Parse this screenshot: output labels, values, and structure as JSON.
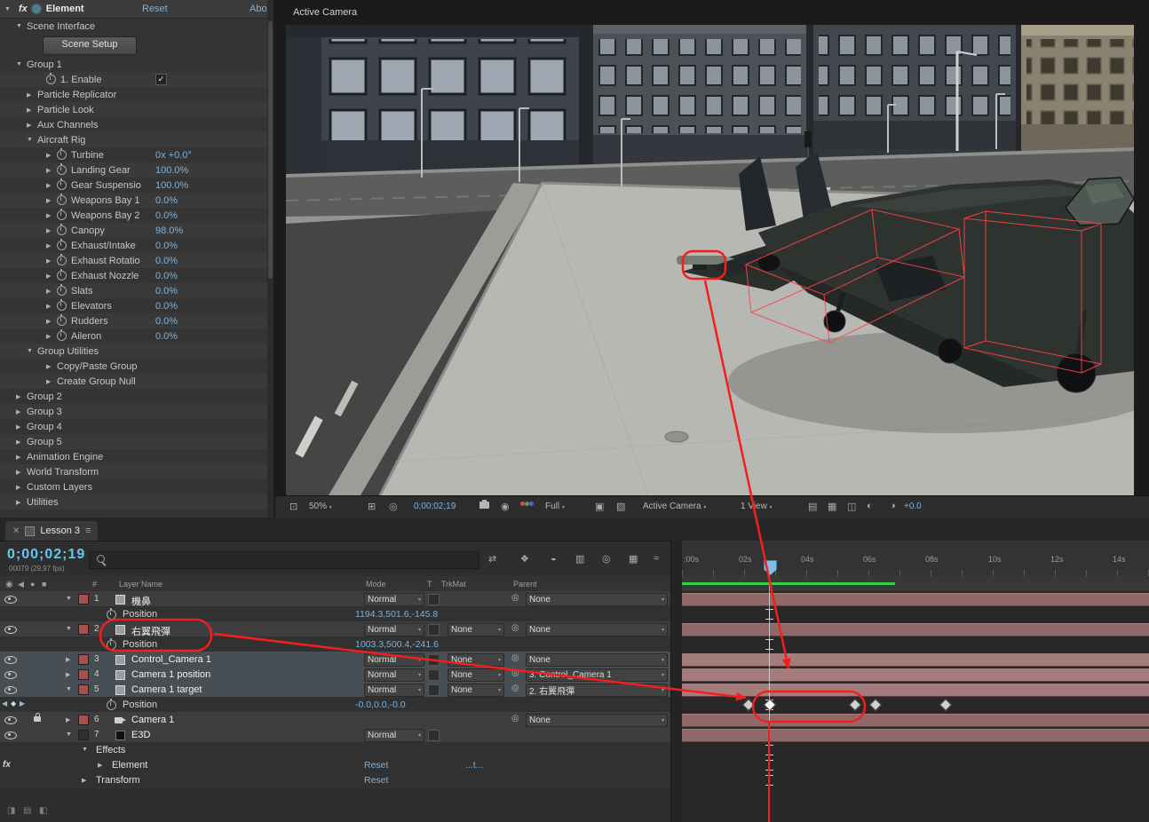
{
  "colors": {
    "accent_blue": "#7fb2d9",
    "time_blue": "#64c8f0",
    "annotation_red": "#f51d1d",
    "layer_bar": "#906867",
    "render_green": "#35d04a"
  },
  "effect_panel": {
    "title": "Element",
    "reset_label": "Reset",
    "about_label": "Abo",
    "scene_interface_label": "Scene Interface",
    "scene_setup_button": "Scene Setup",
    "group1": {
      "label": "Group 1",
      "enable_label": "1. Enable",
      "enable_check": "✓"
    },
    "top_params": [
      {
        "label": "Particle Replicator"
      },
      {
        "label": "Particle Look"
      },
      {
        "label": "Aux Channels"
      }
    ],
    "aircraft_rig": {
      "label": "Aircraft Rig",
      "params": [
        {
          "name": "Turbine",
          "value": "0x +0.0°"
        },
        {
          "name": "Landing Gear",
          "value": "100.0%"
        },
        {
          "name": "Gear Suspensio",
          "value": "100.0%"
        },
        {
          "name": "Weapons Bay 1",
          "value": "0.0%"
        },
        {
          "name": "Weapons Bay 2",
          "value": "0.0%"
        },
        {
          "name": "Canopy",
          "value": "98.0%"
        },
        {
          "name": "Exhaust/Intake",
          "value": "0.0%"
        },
        {
          "name": "Exhaust Rotatio",
          "value": "0.0%"
        },
        {
          "name": "Exhaust Nozzle",
          "value": "0.0%"
        },
        {
          "name": "Slats",
          "value": "0.0%"
        },
        {
          "name": "Elevators",
          "value": "0.0%"
        },
        {
          "name": "Rudders",
          "value": "0.0%"
        },
        {
          "name": "Aileron",
          "value": "0.0%"
        }
      ]
    },
    "group_utilities": {
      "label": "Group Utilities",
      "items": [
        {
          "label": "Copy/Paste Group"
        },
        {
          "label": "Create Group Null"
        }
      ]
    },
    "bottom_groups": [
      {
        "label": "Group 2"
      },
      {
        "label": "Group 3"
      },
      {
        "label": "Group 4"
      },
      {
        "label": "Group 5"
      },
      {
        "label": "Animation Engine"
      },
      {
        "label": "World Transform"
      },
      {
        "label": "Custom Layers"
      },
      {
        "label": "Utilities"
      }
    ]
  },
  "viewer": {
    "camera_label": "Active Camera",
    "toolbar": {
      "magnification": "50%",
      "time": "0;00;02;19",
      "resolution": "Full",
      "camera_view": "Active Camera",
      "view_layout": "1 View",
      "exposure": "+0.0"
    }
  },
  "timeline": {
    "tab_label": "Lesson 3",
    "time_display": "0;00;02;19",
    "frame_info": "00079 (29.97 fps)",
    "columns": {
      "hash": "#",
      "name": "Layer Name",
      "mode": "Mode",
      "t": "T",
      "trkmat": "TrkMat",
      "parent": "Parent"
    },
    "ruler": [
      ":00s",
      "02s",
      "04s",
      "06s",
      "08s",
      "10s",
      "12s",
      "14s"
    ],
    "layers": [
      {
        "num": "1",
        "name": "機鼻",
        "mode": "Normal",
        "parent": "None",
        "prop_name": "Position",
        "prop_value": "1194.3,501.6,-145.8"
      },
      {
        "num": "2",
        "name": "右翼飛彈",
        "mode": "Normal",
        "trkmat": "None",
        "parent": "None",
        "prop_name": "Position",
        "prop_value": "1003.3,500.4,-241.6"
      },
      {
        "num": "3",
        "name": "Control_Camera 1",
        "mode": "Normal",
        "trkmat": "None",
        "parent": "None"
      },
      {
        "num": "4",
        "name": "Camera 1 position",
        "mode": "Normal",
        "trkmat": "None",
        "parent": "3. Control_Camera 1"
      },
      {
        "num": "5",
        "name": "Camera 1 target",
        "mode": "Normal",
        "trkmat": "None",
        "parent": "2. 右翼飛彈",
        "prop_name": "Position",
        "prop_value": "-0.0,0.0,-0.0"
      },
      {
        "num": "6",
        "name": "Camera 1",
        "parent": "None"
      },
      {
        "num": "7",
        "name": "E3D",
        "mode": "Normal"
      }
    ],
    "e3d": {
      "effects_label": "Effects",
      "element_label": "Element",
      "element_reset": "Reset",
      "element_about": "...t...",
      "transform_label": "Transform",
      "transform_reset": "Reset"
    }
  }
}
